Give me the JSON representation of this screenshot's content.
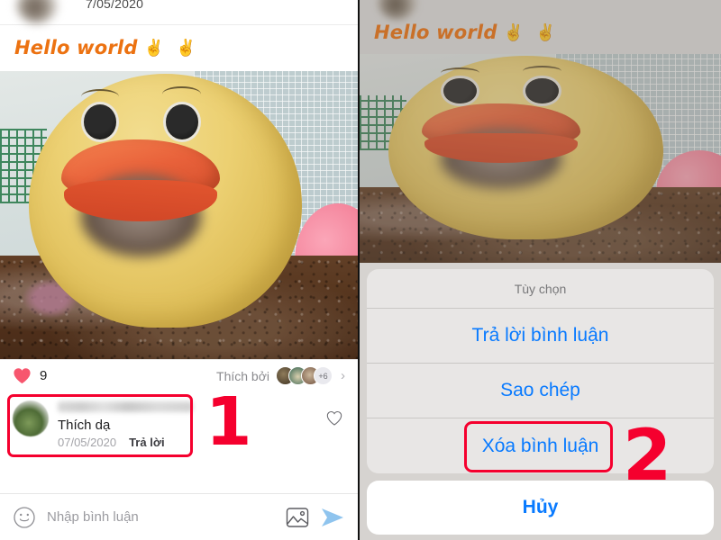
{
  "colors": {
    "accent_blue": "#087aff",
    "marker_red": "#f5002e",
    "caption_orange": "#ec7211",
    "heart_red": "#f7566e",
    "sheet_bg": "#e9e7e5"
  },
  "left_panel": {
    "topbar": {
      "date": "7/05/2020",
      "avatar_name": "blurred-avatar"
    },
    "caption": {
      "text": "Hello world",
      "emoji": "✌️ ✌️"
    },
    "photo": {
      "alt": "yellow duck statue photo"
    },
    "likes": {
      "count": "9",
      "liked_by_label": "Thích bởi",
      "more_badge": "+6",
      "chevron": "›"
    },
    "comment": {
      "username_blurred": "blurred-username",
      "text": "Thích dạ",
      "date": "07/05/2020",
      "reply_label": "Trả lời"
    },
    "composer": {
      "placeholder": "Nhập bình luận",
      "emoji_icon": "smiley-icon",
      "image_icon": "image-icon",
      "send_icon": "send-icon"
    },
    "annotation": {
      "number": "1"
    }
  },
  "right_panel": {
    "caption": {
      "text": "Hello world",
      "emoji": "✌️ ✌️"
    },
    "action_sheet": {
      "title": "Tùy chọn",
      "items": [
        {
          "label": "Trả lời bình luận",
          "highlighted": false
        },
        {
          "label": "Sao chép",
          "highlighted": false
        },
        {
          "label": "Xóa bình luận",
          "highlighted": true
        }
      ],
      "cancel_label": "Hủy"
    },
    "annotation": {
      "number": "2"
    }
  }
}
